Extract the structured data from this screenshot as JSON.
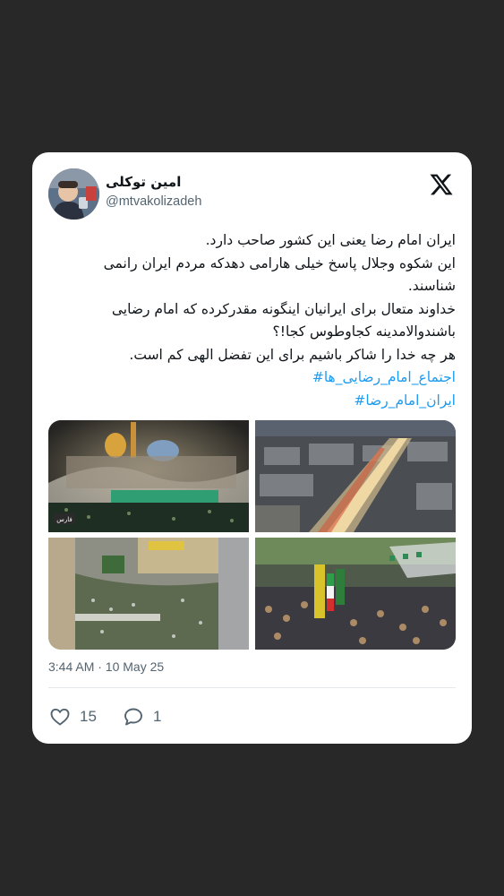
{
  "author": {
    "display_name": "امین توکلی",
    "handle": "@mtvakolizadeh"
  },
  "brand_icon": "x-logo-icon",
  "tweet": {
    "lines": [
      "ایران امام رضا یعنی این کشور صاحب دارد.",
      "این شکوه وجلال پاسخ خیلی هارامی دهدکه مردم ایران رانمی",
      "شناسند.",
      "خداوند متعال برای ایرانیان اینگونه مقدرکرده که امام رضایی",
      "باشندوالامدینه کجاوطوس کجا!؟",
      "هر چه خدا را شاکر باشیم برای این تفضل الهی کم است."
    ],
    "hashtags": [
      "اجتماع_امام_رضایی_ها#",
      "ایران_امام_رضا#"
    ]
  },
  "media": {
    "photos": [
      {
        "name": "shrine-night-photo",
        "caption_mark": "فارس"
      },
      {
        "name": "street-aerial-night-photo"
      },
      {
        "name": "crowd-aerial-day-photo"
      },
      {
        "name": "crowd-flags-photo"
      }
    ]
  },
  "meta": {
    "timestamp": "3:44 AM · 10 May 25"
  },
  "actions": {
    "likes": "15",
    "replies": "1"
  },
  "colors": {
    "background": "#282828",
    "card": "#ffffff",
    "text": "#0f1419",
    "secondary": "#536471",
    "hashtag": "#1d9bf0"
  }
}
